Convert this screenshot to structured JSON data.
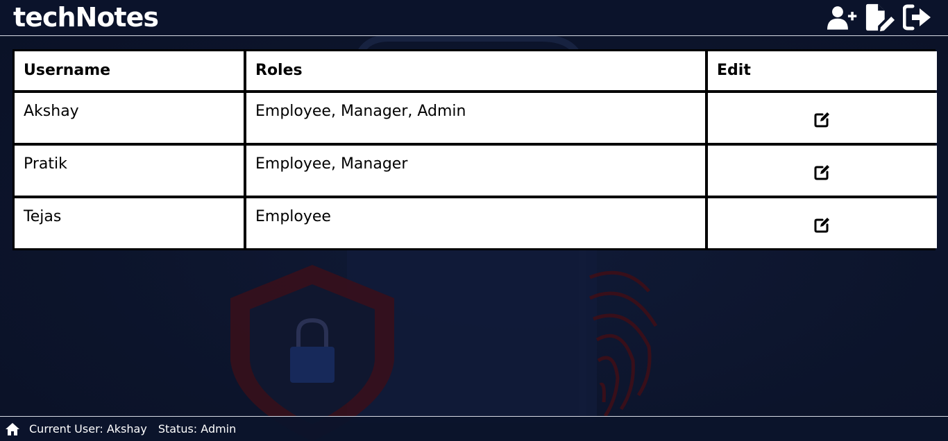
{
  "app": {
    "title": "techNotes"
  },
  "header": {
    "actions": [
      {
        "icon": "user-plus-icon",
        "label": "Add User"
      },
      {
        "icon": "file-pen-icon",
        "label": "Add Note"
      },
      {
        "icon": "logout-icon",
        "label": "Logout"
      }
    ]
  },
  "table": {
    "columns": [
      "Username",
      "Roles",
      "Edit"
    ],
    "rows": [
      {
        "username": "Akshay",
        "roles": "Employee, Manager, Admin",
        "edit_icon": "edit-icon"
      },
      {
        "username": "Pratik",
        "roles": "Employee, Manager",
        "edit_icon": "edit-icon"
      },
      {
        "username": "Tejas",
        "roles": "Employee",
        "edit_icon": "edit-icon"
      }
    ]
  },
  "footer": {
    "home_icon": "home-icon",
    "current_user": "Current User: Akshay",
    "status": "Status: Admin"
  },
  "colors": {
    "background": "#0c142b",
    "text_light": "#ffffff",
    "table_bg": "#ffffff",
    "table_border": "#000000",
    "bg_shield": "#3a0f1a",
    "bg_lock": "#17295a"
  }
}
